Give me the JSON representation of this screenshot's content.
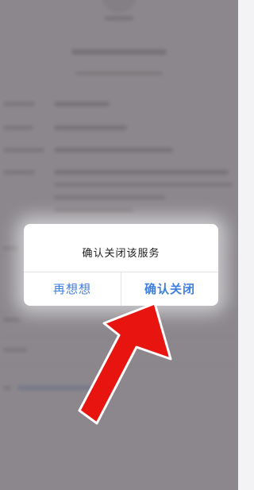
{
  "dialog": {
    "message": "确认关闭该服务",
    "cancel_label": "再想想",
    "confirm_label": "确认关闭"
  },
  "colors": {
    "button_text": "#3d7fe0",
    "overlay": "#5a545c",
    "arrow": "#e8140f",
    "dialog_bg": "#ffffff"
  },
  "annotation": {
    "arrow_icon": "red-pointer-arrow",
    "points_to": "confirm-close-button"
  }
}
